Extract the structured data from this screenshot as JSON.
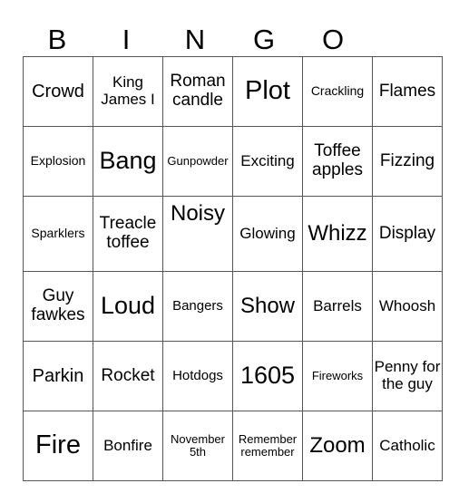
{
  "header": {
    "letters": [
      "B",
      "I",
      "N",
      "G",
      "O"
    ]
  },
  "grid": {
    "rows": [
      [
        "Crowd",
        "King James I",
        "Roman candle",
        "Plot",
        "Crackling",
        "Flames"
      ],
      [
        "Explosion",
        "Bang",
        "Gunpowder",
        "Exciting",
        "Toffee apples",
        "Fizzing"
      ],
      [
        "Sparklers",
        "Treacle toffee",
        "Noisy",
        "Glowing",
        "Whizz",
        "Display"
      ],
      [
        "Guy fawkes",
        "Loud",
        "Bangers",
        "Show",
        "Barrels",
        "Whoosh"
      ],
      [
        "Parkin",
        "Rocket",
        "Hotdogs",
        "1605",
        "Fireworks",
        "Penny for the guy"
      ],
      [
        "Fire",
        "Bonfire",
        "November 5th",
        "Remember remember",
        "Zoom",
        "Catholic"
      ]
    ]
  }
}
